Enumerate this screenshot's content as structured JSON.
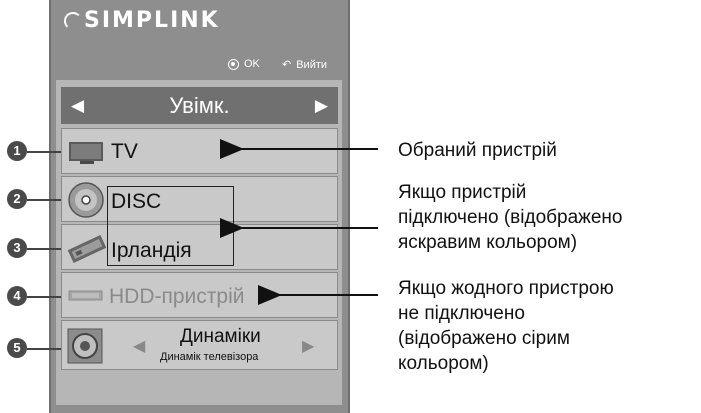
{
  "logo": {
    "text": "SIMPLINK"
  },
  "hints": {
    "ok": "OK",
    "exit": "Вийти"
  },
  "selector": {
    "value": "Увімк."
  },
  "devices": [
    {
      "number": "1",
      "label": "TV"
    },
    {
      "number": "2",
      "label": "DISC"
    },
    {
      "number": "3",
      "label": "Ірландія"
    },
    {
      "number": "4",
      "label": "HDD-пристрій"
    },
    {
      "number": "5",
      "label": "Динаміки",
      "sublabel": "Динамік телевізора"
    }
  ],
  "annotations": {
    "selected": "Обраний пристрій",
    "connected": [
      "Якщо пристрій",
      "підключено (відображено",
      "яскравим кольором)"
    ],
    "not_connected": [
      "Якщо жодного пристрою",
      "не підключено",
      "(відображено сірим",
      "кольором)"
    ]
  }
}
